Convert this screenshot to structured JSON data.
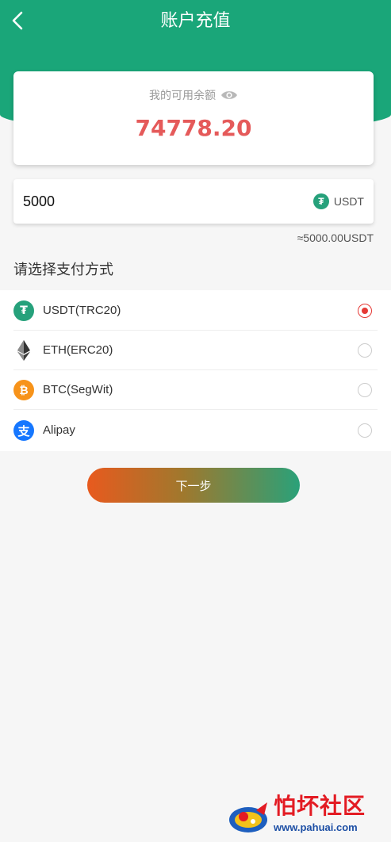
{
  "header": {
    "title": "账户充值"
  },
  "balance": {
    "label": "我的可用余额",
    "value": "74778.20"
  },
  "amount": {
    "value": "5000",
    "coin": "USDT",
    "approx": "≈5000.00USDT"
  },
  "payment": {
    "title": "请选择支付方式",
    "methods": [
      {
        "label": "USDT(TRC20)",
        "icon": "tether-icon",
        "color": "#26a17b",
        "selected": true
      },
      {
        "label": "ETH(ERC20)",
        "icon": "ethereum-icon",
        "color": "#3c3c3d",
        "selected": false
      },
      {
        "label": "BTC(SegWit)",
        "icon": "bitcoin-icon",
        "color": "#f7931a",
        "selected": false
      },
      {
        "label": "Alipay",
        "icon": "alipay-icon",
        "color": "#1677ff",
        "selected": false
      }
    ]
  },
  "next_button": {
    "label": "下一步"
  },
  "watermark": {
    "title": "怕坏社区",
    "url": "www.pahuai.com"
  },
  "colors": {
    "brand": "#1aa679",
    "balance": "#e55a5a",
    "radio_selected": "#e53935"
  }
}
